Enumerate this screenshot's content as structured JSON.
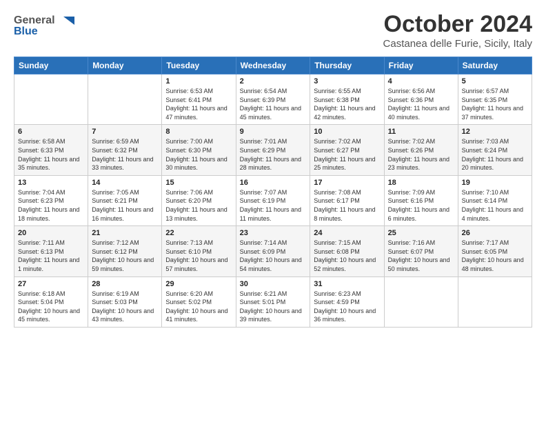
{
  "header": {
    "logo_general": "General",
    "logo_blue": "Blue",
    "month_title": "October 2024",
    "location": "Castanea delle Furie, Sicily, Italy"
  },
  "weekdays": [
    "Sunday",
    "Monday",
    "Tuesday",
    "Wednesday",
    "Thursday",
    "Friday",
    "Saturday"
  ],
  "weeks": [
    [
      {
        "day": "",
        "info": ""
      },
      {
        "day": "",
        "info": ""
      },
      {
        "day": "1",
        "info": "Sunrise: 6:53 AM\nSunset: 6:41 PM\nDaylight: 11 hours and 47 minutes."
      },
      {
        "day": "2",
        "info": "Sunrise: 6:54 AM\nSunset: 6:39 PM\nDaylight: 11 hours and 45 minutes."
      },
      {
        "day": "3",
        "info": "Sunrise: 6:55 AM\nSunset: 6:38 PM\nDaylight: 11 hours and 42 minutes."
      },
      {
        "day": "4",
        "info": "Sunrise: 6:56 AM\nSunset: 6:36 PM\nDaylight: 11 hours and 40 minutes."
      },
      {
        "day": "5",
        "info": "Sunrise: 6:57 AM\nSunset: 6:35 PM\nDaylight: 11 hours and 37 minutes."
      }
    ],
    [
      {
        "day": "6",
        "info": "Sunrise: 6:58 AM\nSunset: 6:33 PM\nDaylight: 11 hours and 35 minutes."
      },
      {
        "day": "7",
        "info": "Sunrise: 6:59 AM\nSunset: 6:32 PM\nDaylight: 11 hours and 33 minutes."
      },
      {
        "day": "8",
        "info": "Sunrise: 7:00 AM\nSunset: 6:30 PM\nDaylight: 11 hours and 30 minutes."
      },
      {
        "day": "9",
        "info": "Sunrise: 7:01 AM\nSunset: 6:29 PM\nDaylight: 11 hours and 28 minutes."
      },
      {
        "day": "10",
        "info": "Sunrise: 7:02 AM\nSunset: 6:27 PM\nDaylight: 11 hours and 25 minutes."
      },
      {
        "day": "11",
        "info": "Sunrise: 7:02 AM\nSunset: 6:26 PM\nDaylight: 11 hours and 23 minutes."
      },
      {
        "day": "12",
        "info": "Sunrise: 7:03 AM\nSunset: 6:24 PM\nDaylight: 11 hours and 20 minutes."
      }
    ],
    [
      {
        "day": "13",
        "info": "Sunrise: 7:04 AM\nSunset: 6:23 PM\nDaylight: 11 hours and 18 minutes."
      },
      {
        "day": "14",
        "info": "Sunrise: 7:05 AM\nSunset: 6:21 PM\nDaylight: 11 hours and 16 minutes."
      },
      {
        "day": "15",
        "info": "Sunrise: 7:06 AM\nSunset: 6:20 PM\nDaylight: 11 hours and 13 minutes."
      },
      {
        "day": "16",
        "info": "Sunrise: 7:07 AM\nSunset: 6:19 PM\nDaylight: 11 hours and 11 minutes."
      },
      {
        "day": "17",
        "info": "Sunrise: 7:08 AM\nSunset: 6:17 PM\nDaylight: 11 hours and 8 minutes."
      },
      {
        "day": "18",
        "info": "Sunrise: 7:09 AM\nSunset: 6:16 PM\nDaylight: 11 hours and 6 minutes."
      },
      {
        "day": "19",
        "info": "Sunrise: 7:10 AM\nSunset: 6:14 PM\nDaylight: 11 hours and 4 minutes."
      }
    ],
    [
      {
        "day": "20",
        "info": "Sunrise: 7:11 AM\nSunset: 6:13 PM\nDaylight: 11 hours and 1 minute."
      },
      {
        "day": "21",
        "info": "Sunrise: 7:12 AM\nSunset: 6:12 PM\nDaylight: 10 hours and 59 minutes."
      },
      {
        "day": "22",
        "info": "Sunrise: 7:13 AM\nSunset: 6:10 PM\nDaylight: 10 hours and 57 minutes."
      },
      {
        "day": "23",
        "info": "Sunrise: 7:14 AM\nSunset: 6:09 PM\nDaylight: 10 hours and 54 minutes."
      },
      {
        "day": "24",
        "info": "Sunrise: 7:15 AM\nSunset: 6:08 PM\nDaylight: 10 hours and 52 minutes."
      },
      {
        "day": "25",
        "info": "Sunrise: 7:16 AM\nSunset: 6:07 PM\nDaylight: 10 hours and 50 minutes."
      },
      {
        "day": "26",
        "info": "Sunrise: 7:17 AM\nSunset: 6:05 PM\nDaylight: 10 hours and 48 minutes."
      }
    ],
    [
      {
        "day": "27",
        "info": "Sunrise: 6:18 AM\nSunset: 5:04 PM\nDaylight: 10 hours and 45 minutes."
      },
      {
        "day": "28",
        "info": "Sunrise: 6:19 AM\nSunset: 5:03 PM\nDaylight: 10 hours and 43 minutes."
      },
      {
        "day": "29",
        "info": "Sunrise: 6:20 AM\nSunset: 5:02 PM\nDaylight: 10 hours and 41 minutes."
      },
      {
        "day": "30",
        "info": "Sunrise: 6:21 AM\nSunset: 5:01 PM\nDaylight: 10 hours and 39 minutes."
      },
      {
        "day": "31",
        "info": "Sunrise: 6:23 AM\nSunset: 4:59 PM\nDaylight: 10 hours and 36 minutes."
      },
      {
        "day": "",
        "info": ""
      },
      {
        "day": "",
        "info": ""
      }
    ]
  ]
}
